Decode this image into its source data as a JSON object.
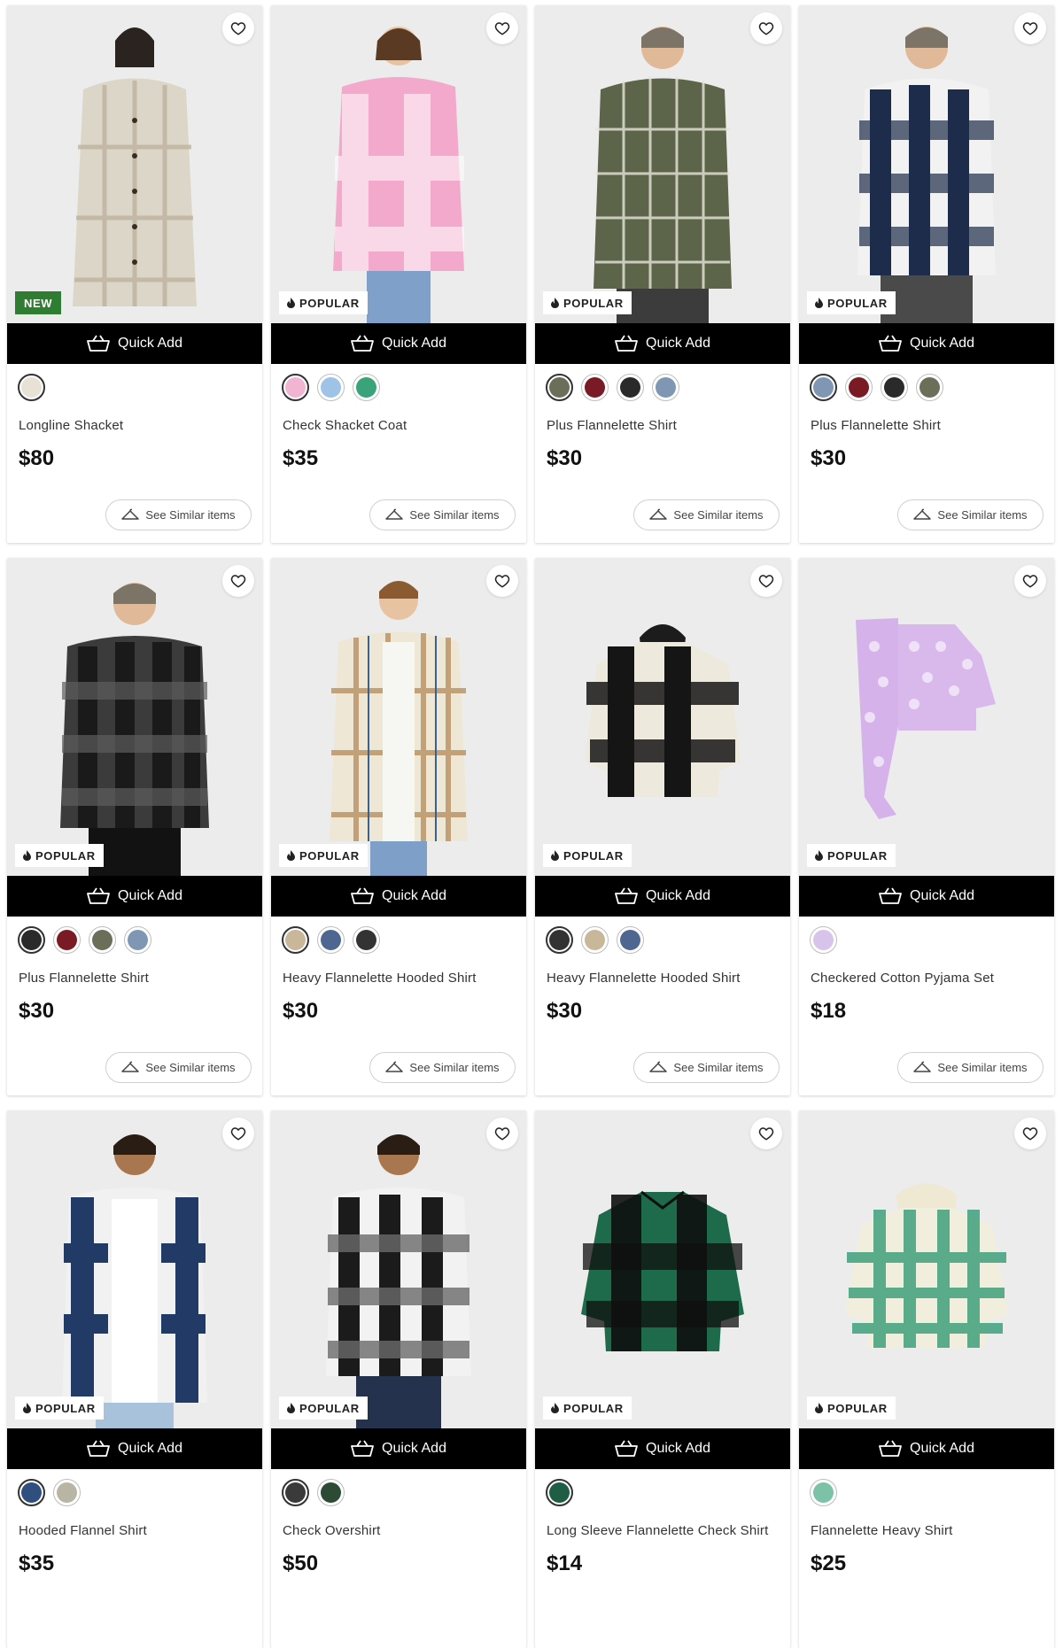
{
  "labels": {
    "quick_add": "Quick Add",
    "see_similar": "See Similar items"
  },
  "colors": {
    "quick_add_bg": "#000000",
    "new_badge_bg": "#2e7d32",
    "popular_badge_bg": "#ffffff"
  },
  "products": [
    {
      "name": "Longline Shacket",
      "price": "$80",
      "badge": "NEW",
      "swatches": [
        "#e8e2d6"
      ]
    },
    {
      "name": "Check Shacket Coat",
      "price": "$35",
      "badge": "POPULAR",
      "swatches": [
        "#f1b5d3",
        "#9fc3e6",
        "#3aa37a"
      ]
    },
    {
      "name": "Plus Flannelette Shirt",
      "price": "$30",
      "badge": "POPULAR",
      "swatches": [
        "#6b6f5a",
        "#7a1a24",
        "#2a2a2a",
        "#7f97b3"
      ]
    },
    {
      "name": "Plus Flannelette Shirt",
      "price": "$30",
      "badge": "POPULAR",
      "swatches": [
        "#7f97b3",
        "#7a1a24",
        "#2a2a2a",
        "#6b6f5a"
      ]
    },
    {
      "name": "Plus Flannelette Shirt",
      "price": "$30",
      "badge": "POPULAR",
      "swatches": [
        "#2a2a2a",
        "#7a1a24",
        "#6b6f5a",
        "#7f97b3"
      ]
    },
    {
      "name": "Heavy Flannelette Hooded Shirt",
      "price": "$30",
      "badge": "POPULAR",
      "swatches": [
        "#c9b79a",
        "#4d6790",
        "#333333"
      ]
    },
    {
      "name": "Heavy Flannelette Hooded Shirt",
      "price": "$30",
      "badge": "POPULAR",
      "swatches": [
        "#333333",
        "#c9b79a",
        "#4d6790"
      ]
    },
    {
      "name": "Checkered Cotton Pyjama Set",
      "price": "$18",
      "badge": "POPULAR",
      "swatches": [
        "#d8c3ea"
      ]
    },
    {
      "name": "Hooded Flannel Shirt",
      "price": "$35",
      "badge": "POPULAR",
      "swatches": [
        "#2f4f7e",
        "#b8b5a4"
      ]
    },
    {
      "name": "Check Overshirt",
      "price": "$50",
      "badge": "POPULAR",
      "swatches": [
        "#3a3a3a",
        "#2d4a35"
      ]
    },
    {
      "name": "Long Sleeve Flannelette Check Shirt",
      "price": "$14",
      "badge": "POPULAR",
      "swatches": [
        "#1f5e44"
      ]
    },
    {
      "name": "Flannelette Heavy Shirt",
      "price": "$25",
      "badge": "POPULAR",
      "swatches": [
        "#7cc2a6"
      ]
    }
  ]
}
